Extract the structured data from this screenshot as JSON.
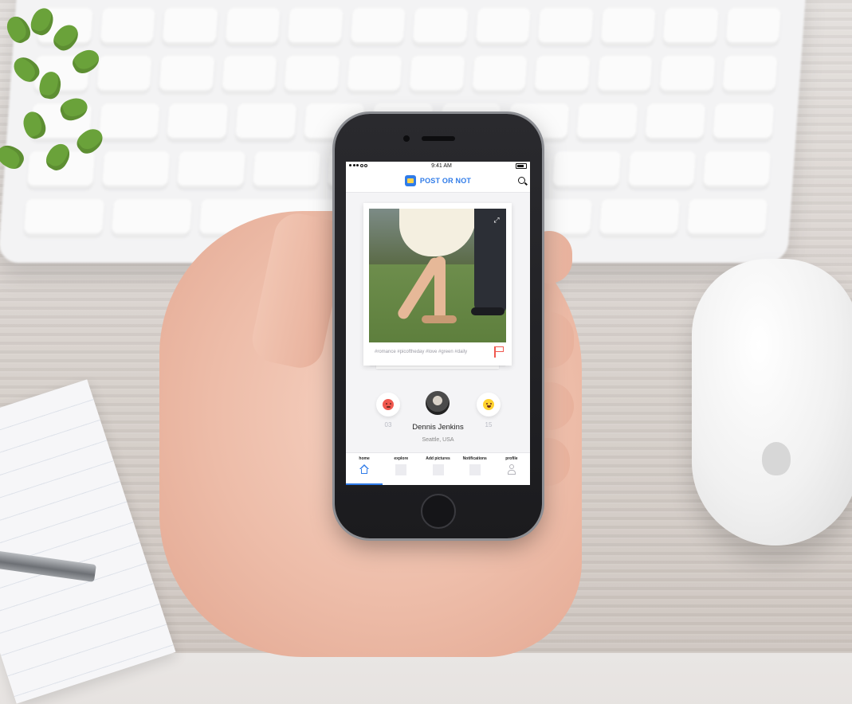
{
  "status_bar": {
    "time": "9:41 AM"
  },
  "header": {
    "title": "POST OR NOT"
  },
  "post": {
    "hashtags": "#romance #picoftheday #love #green #daily",
    "angry_count": "03",
    "happy_count": "15"
  },
  "user": {
    "name": "Dennis Jenkins",
    "location": "Seattle, USA"
  },
  "tabs": [
    {
      "label": "home",
      "icon": "home-icon"
    },
    {
      "label": "explore",
      "icon": "explore-icon"
    },
    {
      "label": "Add pictures",
      "icon": "add-pictures-icon"
    },
    {
      "label": "Notifications",
      "icon": "notifications-icon"
    },
    {
      "label": "profile",
      "icon": "profile-icon"
    }
  ],
  "colors": {
    "accent": "#2f7be8",
    "flag": "#f0584f",
    "angry": "#f0584f",
    "happy": "#ffd22e"
  }
}
